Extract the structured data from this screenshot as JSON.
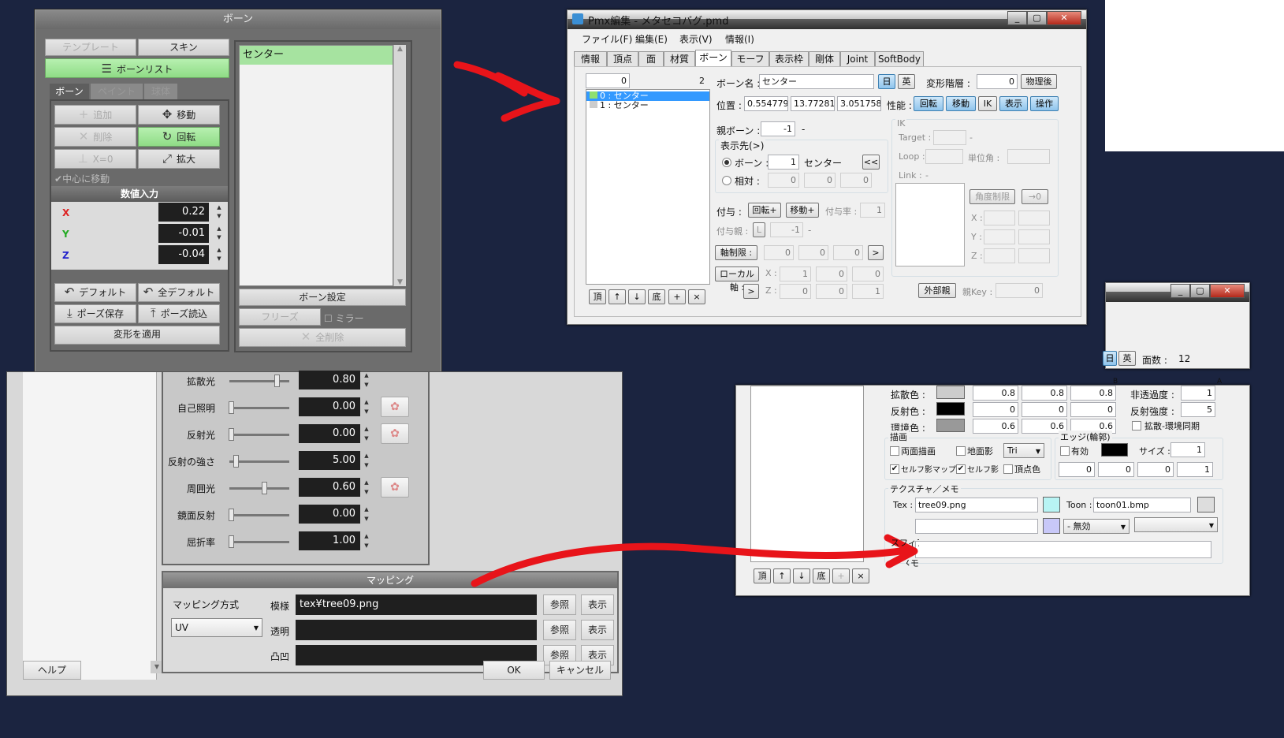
{
  "bone_panel": {
    "title": "ボーン",
    "template": "テンプレート",
    "skin": "スキン",
    "bone_list": "ボーンリスト",
    "tabs": [
      "ボーン",
      "ペイント",
      "球体"
    ],
    "add": "追加",
    "move": "移動",
    "delete": "削除",
    "rotate": "回転",
    "x0": "X=0",
    "scale": "拡大",
    "center_move": "中心に移動",
    "numeric_title": "数値入力",
    "x_label": "X",
    "x_val": "0.22",
    "y_label": "Y",
    "y_val": "-0.01",
    "z_label": "Z",
    "z_val": "-0.04",
    "default": "デフォルト",
    "all_default": "全デフォルト",
    "pose_save": "ポーズ保存",
    "pose_load": "ポーズ読込",
    "apply_transform": "変形を適用",
    "list_item": "センター",
    "bone_settings": "ボーン設定",
    "freeze": "フリーズ",
    "mirror": "ミラー",
    "delete_all": "全削除"
  },
  "pmx_editor": {
    "title": "Pmx編集 - メタセコバグ.pmd",
    "menu": [
      "ファイル(F)",
      "編集(E)",
      "表示(V)",
      "情報(I)"
    ],
    "tabs": [
      "情報",
      "頂点",
      "面",
      "材質",
      "ボーン",
      "モーフ",
      "表示枠",
      "剛体",
      "Joint",
      "SoftBody"
    ],
    "count_input": "0",
    "count": "2",
    "bones": [
      "0 : センター",
      "1 : センター"
    ],
    "list_buttons": [
      "頂",
      "↑",
      "↓",
      "底",
      "+",
      "×"
    ],
    "bone_name_label": "ボーン名 :",
    "bone_name": "センター",
    "jp": "日",
    "en": "英",
    "deform_label": "変形階層 :",
    "deform_val": "0",
    "after_physics": "物理後",
    "pos_label": "位置 :",
    "pos": [
      "0.5547791",
      "13.77281",
      "3.051758E"
    ],
    "perf_label": "性能 :",
    "perf_buttons": [
      "回転",
      "移動",
      "IK",
      "表示",
      "操作"
    ],
    "parent_label": "親ボーン :",
    "parent_val": "-1",
    "parent_dash": "-",
    "display_to": "表示先(>)",
    "radio_bone": "ボーン :",
    "radio_bone_val": "1",
    "radio_bone_name": "センター",
    "radio_rel": "相対 :",
    "rel_vals": [
      "0",
      "0",
      "0"
    ],
    "back_btn": "<<",
    "ik": "IK",
    "target": "Target :",
    "target_dash": "-",
    "loop": "Loop :",
    "unit_angle": "単位角 :",
    "link": "Link :",
    "link_dash": "-",
    "angle_limit": "角度制限",
    "to_zero": "→0",
    "xyz": [
      "X :",
      "Y :",
      "Z :"
    ],
    "grant_label": "付与 :",
    "grant_rot": "回転+",
    "grant_move": "移動+",
    "grant_rate": "付与率 :",
    "grant_rate_val": "1",
    "grant_parent": "付与親 :",
    "grant_parent_l": "L",
    "grant_parent_val": "-1",
    "grant_parent_dash": "-",
    "axis_limit": "軸制限 :",
    "axis_vals": [
      "0",
      "0",
      "0"
    ],
    "local_axis": "ローカル軸 :",
    "local_x_vals": [
      "1",
      "0",
      "0"
    ],
    "local_z_vals": [
      "0",
      "0",
      "1"
    ],
    "x_lbl": "X :",
    "z_lbl": "Z :",
    "ext_parent": "外部親",
    "parent_key": "親Key :",
    "parent_key_val": "0"
  },
  "material_panel": {
    "labels": [
      "拡散光",
      "自己照明",
      "反射光",
      "反射の強さ",
      "周囲光",
      "鏡面反射",
      "屈折率"
    ],
    "values": [
      "0.80",
      "0.00",
      "0.00",
      "5.00",
      "0.60",
      "0.00",
      "1.00"
    ],
    "mapping_title": "マッピング",
    "mapping_method": "マッピング方式",
    "uv": "UV",
    "tex_label": "模様",
    "tex_val": "tex¥tree09.png",
    "alpha_label": "透明",
    "bump_label": "凸凹",
    "browse": "参照",
    "show": "表示",
    "help": "ヘルプ",
    "ok": "OK",
    "cancel": "キャンセル"
  },
  "material_editor": {
    "jp": "日",
    "en": "英",
    "faces_label": "面数 :",
    "faces_val": "12",
    "B": "B",
    "A": "A",
    "diffuse_label": "拡散色 :",
    "diffuse_vals": [
      "0.8",
      "0.8",
      "0.8"
    ],
    "specular_label": "反射色 :",
    "specular_vals": [
      "0",
      "0",
      "0"
    ],
    "ambient_label": "環境色 :",
    "ambient_vals": [
      "0.6",
      "0.6",
      "0.6"
    ],
    "alpha_label": "非透過度 :",
    "alpha_val": "1",
    "spec_power_label": "反射強度 :",
    "spec_power_val": "5",
    "diffuse_env_sync": "拡散-環境同期",
    "draw_group": "描画",
    "double_sided": "両面描画",
    "ground_shadow": "地面影",
    "tri": "Tri",
    "self_shadow_map": "セルフ影マップ",
    "self_shadow": "セルフ影",
    "vertex_color": "頂点色",
    "edge_group": "エッジ(輪郭)",
    "edge_enable": "有効",
    "edge_size": "サイズ :",
    "edge_size_val": "1",
    "edge_vals": [
      "0",
      "0",
      "0",
      "1"
    ],
    "tex_memo": "テクスチャ／メモ",
    "tex_label": "Tex :",
    "tex_val": "tree09.png",
    "toon_label": "Toon :",
    "toon_val": "toon01.bmp",
    "sphere_label": "スフィア :",
    "sphere_mode": "- 無効",
    "memo_label": "メモ :",
    "list_buttons": [
      "頂",
      "↑",
      "↓",
      "底",
      "+",
      "×"
    ]
  },
  "colors": {
    "background": "#1b2440",
    "arrow": "#e8141a",
    "green_active": "#8fdc86"
  }
}
